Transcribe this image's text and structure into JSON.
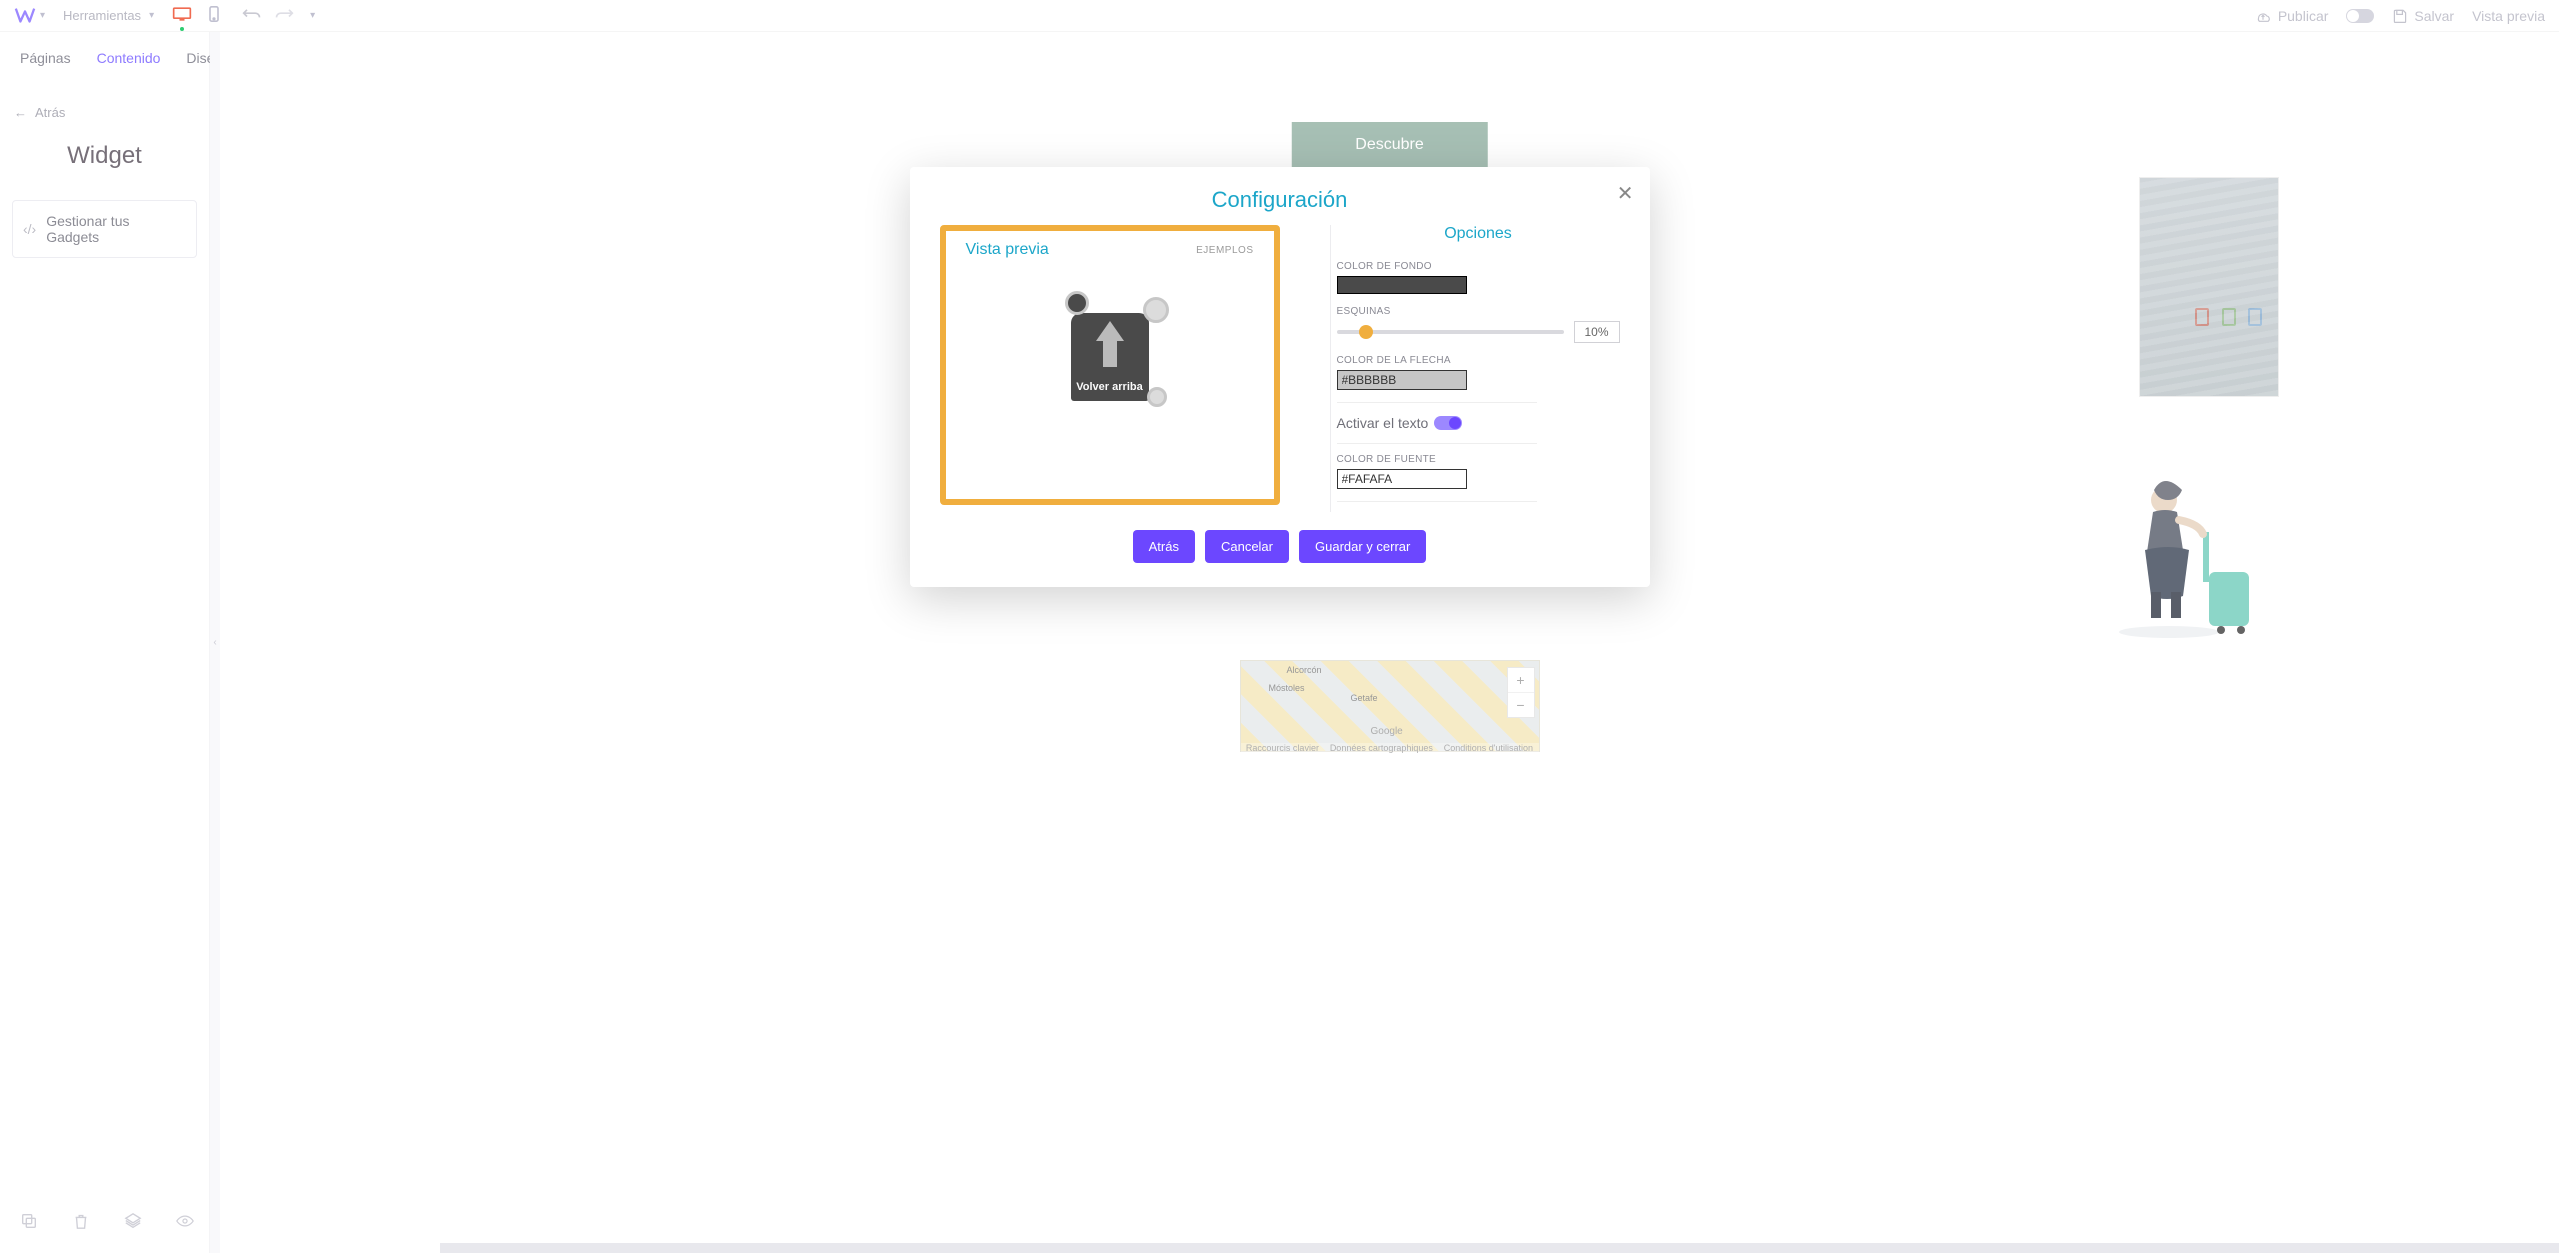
{
  "topbar": {
    "tools": "Herramientas",
    "publish": "Publicar",
    "save": "Salvar",
    "preview_link": "Vista previa"
  },
  "sidebar": {
    "tabs": {
      "pages": "Páginas",
      "content": "Contenido",
      "design": "Diseño"
    },
    "back": "Atrás",
    "title": "Widget",
    "action": "Gestionar tus Gadgets"
  },
  "canvas": {
    "discover": "Descubre",
    "map": {
      "kb": "Raccourcis clavier",
      "data": "Données cartographiques",
      "terms": "Conditions d'utilisation",
      "google": "Google",
      "c1": "Alcorcón",
      "c2": "Móstoles",
      "c3": "Getafe",
      "zoom_in": "+",
      "zoom_out": "−"
    }
  },
  "modal": {
    "title": "Configuración",
    "close": "✕",
    "preview": {
      "title": "Vista previa",
      "examples": "EJEMPLOS",
      "widget_label": "Volver arriba"
    },
    "options": {
      "title": "Opciones",
      "bg_label": "Color de fondo",
      "corners_label": "Esquinas",
      "corners_value": "10%",
      "arrow_label": "Color de la flecha",
      "arrow_value": "#BBBBBB",
      "toggle_label": "Activar el texto",
      "font_label": "Color de fuente",
      "font_value": "#FAFAFA"
    },
    "buttons": {
      "back": "Atrás",
      "cancel": "Cancelar",
      "save": "Guardar y cerrar"
    }
  }
}
